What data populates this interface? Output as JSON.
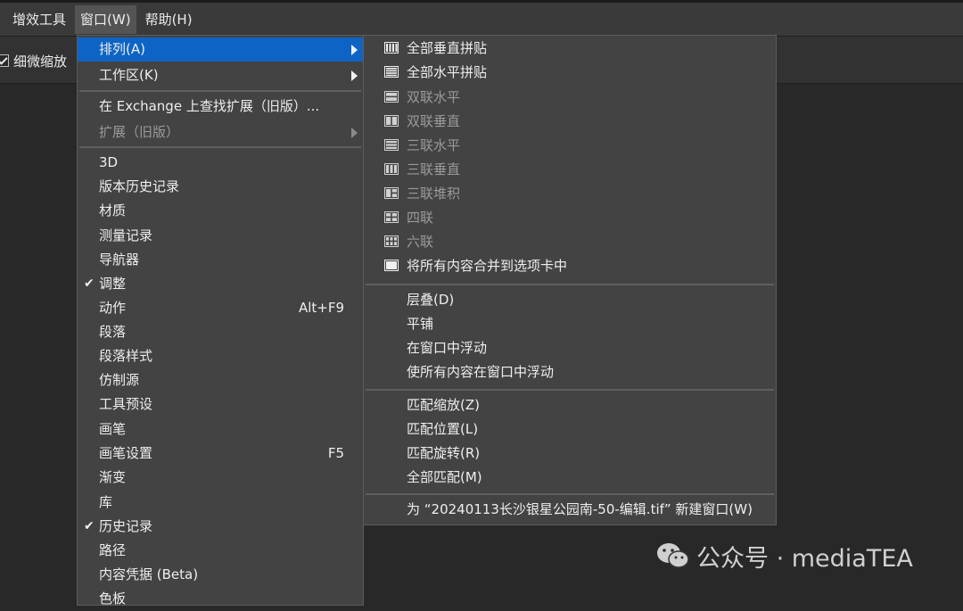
{
  "menubar": {
    "items": [
      "增效工具",
      "窗口(W)",
      "帮助(H)"
    ]
  },
  "options_bar": {
    "scrubby_zoom_label": "细微缩放"
  },
  "window_menu": {
    "items": [
      {
        "label": "排列(A)",
        "state": "highlighted",
        "submenu": true
      },
      {
        "label": "工作区(K)",
        "submenu": true
      },
      {
        "label": "在 Exchange 上查找扩展（旧版）..."
      },
      {
        "label": "扩展（旧版）",
        "state": "disabled",
        "submenu": true
      },
      {
        "label": "3D"
      },
      {
        "label": "版本历史记录"
      },
      {
        "label": "材质"
      },
      {
        "label": "测量记录"
      },
      {
        "label": "导航器"
      },
      {
        "label": "调整",
        "checked": true
      },
      {
        "label": "动作",
        "shortcut": "Alt+F9"
      },
      {
        "label": "段落"
      },
      {
        "label": "段落样式"
      },
      {
        "label": "仿制源"
      },
      {
        "label": "工具预设"
      },
      {
        "label": "画笔"
      },
      {
        "label": "画笔设置",
        "shortcut": "F5"
      },
      {
        "label": "渐变"
      },
      {
        "label": "库"
      },
      {
        "label": "历史记录",
        "checked": true
      },
      {
        "label": "路径"
      },
      {
        "label": "内容凭据 (Beta)"
      },
      {
        "label": "色板"
      }
    ]
  },
  "arrange_submenu": {
    "items": [
      {
        "label": "全部垂直拼贴",
        "icon": "tile-vertical-icon"
      },
      {
        "label": "全部水平拼贴",
        "icon": "tile-horizontal-icon"
      },
      {
        "label": "双联水平",
        "icon": "two-up-horizontal-icon",
        "state": "disabled"
      },
      {
        "label": "双联垂直",
        "icon": "two-up-vertical-icon",
        "state": "disabled"
      },
      {
        "label": "三联水平",
        "icon": "three-up-horizontal-icon",
        "state": "disabled"
      },
      {
        "label": "三联垂直",
        "icon": "three-up-vertical-icon",
        "state": "disabled"
      },
      {
        "label": "三联堆积",
        "icon": "three-up-stacked-icon",
        "state": "disabled"
      },
      {
        "label": "四联",
        "icon": "four-up-icon",
        "state": "disabled"
      },
      {
        "label": "六联",
        "icon": "six-up-icon",
        "state": "disabled"
      },
      {
        "label": "将所有内容合并到选项卡中",
        "icon": "consolidate-tabs-icon"
      },
      {
        "label": "层叠(D)"
      },
      {
        "label": "平铺"
      },
      {
        "label": "在窗口中浮动"
      },
      {
        "label": "使所有内容在窗口中浮动"
      },
      {
        "label": "匹配缩放(Z)"
      },
      {
        "label": "匹配位置(L)"
      },
      {
        "label": "匹配旋转(R)"
      },
      {
        "label": "全部匹配(M)"
      },
      {
        "label": "为 “20240113长沙银星公园南-50-编辑.tif” 新建窗口(W)"
      }
    ]
  },
  "watermark": {
    "text": "公众号 · mediaTEA"
  },
  "colors": {
    "highlight": "#0e64c4",
    "menu_bg": "#434343",
    "workspace_bg": "#282828"
  }
}
